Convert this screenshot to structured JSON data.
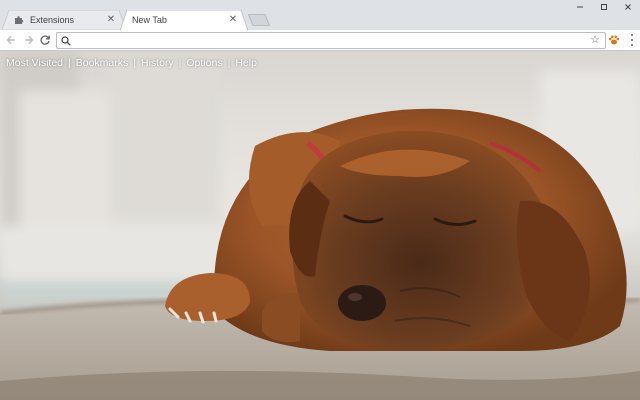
{
  "tabs": [
    {
      "title": "Extensions",
      "icon": "puzzle-icon",
      "active": false
    },
    {
      "title": "New Tab",
      "icon": "",
      "active": true
    }
  ],
  "omnibox": {
    "value": "",
    "placeholder": ""
  },
  "links": {
    "most_visited": "Most Visited",
    "bookmarks": "Bookmarks",
    "history": "History",
    "options": "Options",
    "help": "Help",
    "separator": "|"
  },
  "colors": {
    "tabstrip": "#dee1e6",
    "active_tab": "#ffffff",
    "extension_accent": "#e8710a"
  }
}
